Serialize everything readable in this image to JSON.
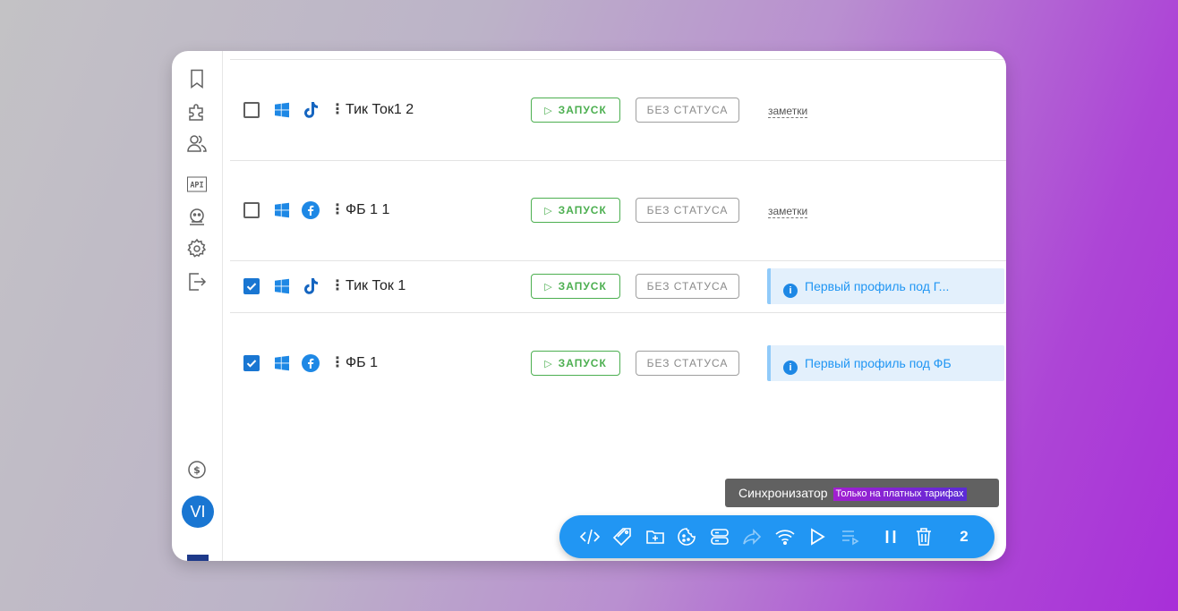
{
  "sidebar": {
    "items": [
      {
        "icon": "bookmark-icon"
      },
      {
        "icon": "extension-icon"
      },
      {
        "icon": "users-icon"
      },
      {
        "icon": "api-icon",
        "label": "API"
      },
      {
        "icon": "bot-icon"
      },
      {
        "icon": "gear-icon"
      },
      {
        "icon": "logout-icon"
      }
    ],
    "billing_icon": "dollar-icon",
    "avatar_initials": "VI"
  },
  "profiles": [
    {
      "name": "Тик Ток1 2",
      "os": "windows",
      "platform": "tiktok",
      "checked": false,
      "run_label": "ЗАПУСК",
      "status_label": "БЕЗ СТАТУСА",
      "notes_label": "заметки",
      "note": ""
    },
    {
      "name": "ФБ 1 1",
      "os": "windows",
      "platform": "facebook",
      "checked": false,
      "run_label": "ЗАПУСК",
      "status_label": "БЕЗ СТАТУСА",
      "notes_label": "заметки",
      "note": ""
    },
    {
      "name": "Тик Ток 1",
      "os": "windows",
      "platform": "tiktok",
      "checked": true,
      "run_label": "ЗАПУСК",
      "status_label": "БЕЗ СТАТУСА",
      "notes_label": "",
      "note": "Первый профиль под Г..."
    },
    {
      "name": "ФБ 1",
      "os": "windows",
      "platform": "facebook",
      "checked": true,
      "run_label": "ЗАПУСК",
      "status_label": "БЕЗ СТАТУСА",
      "notes_label": "",
      "note": "Первый профиль под ФБ"
    }
  ],
  "tooltip": {
    "text": "Синхронизатор",
    "badge": "Только на платных тарифах"
  },
  "toolbar": {
    "icons": [
      "code-icon",
      "tag-icon",
      "folder-add-icon",
      "cookie-icon",
      "server-icon",
      "share-icon",
      "wifi-icon",
      "play-icon",
      "playlist-play-icon",
      "pause-icon",
      "trash-icon"
    ],
    "selected_count": "2"
  },
  "colors": {
    "accent": "#2196f3",
    "run": "#4caf50",
    "checkbox": "#1976d2",
    "note_bg": "#e3f0fc"
  }
}
